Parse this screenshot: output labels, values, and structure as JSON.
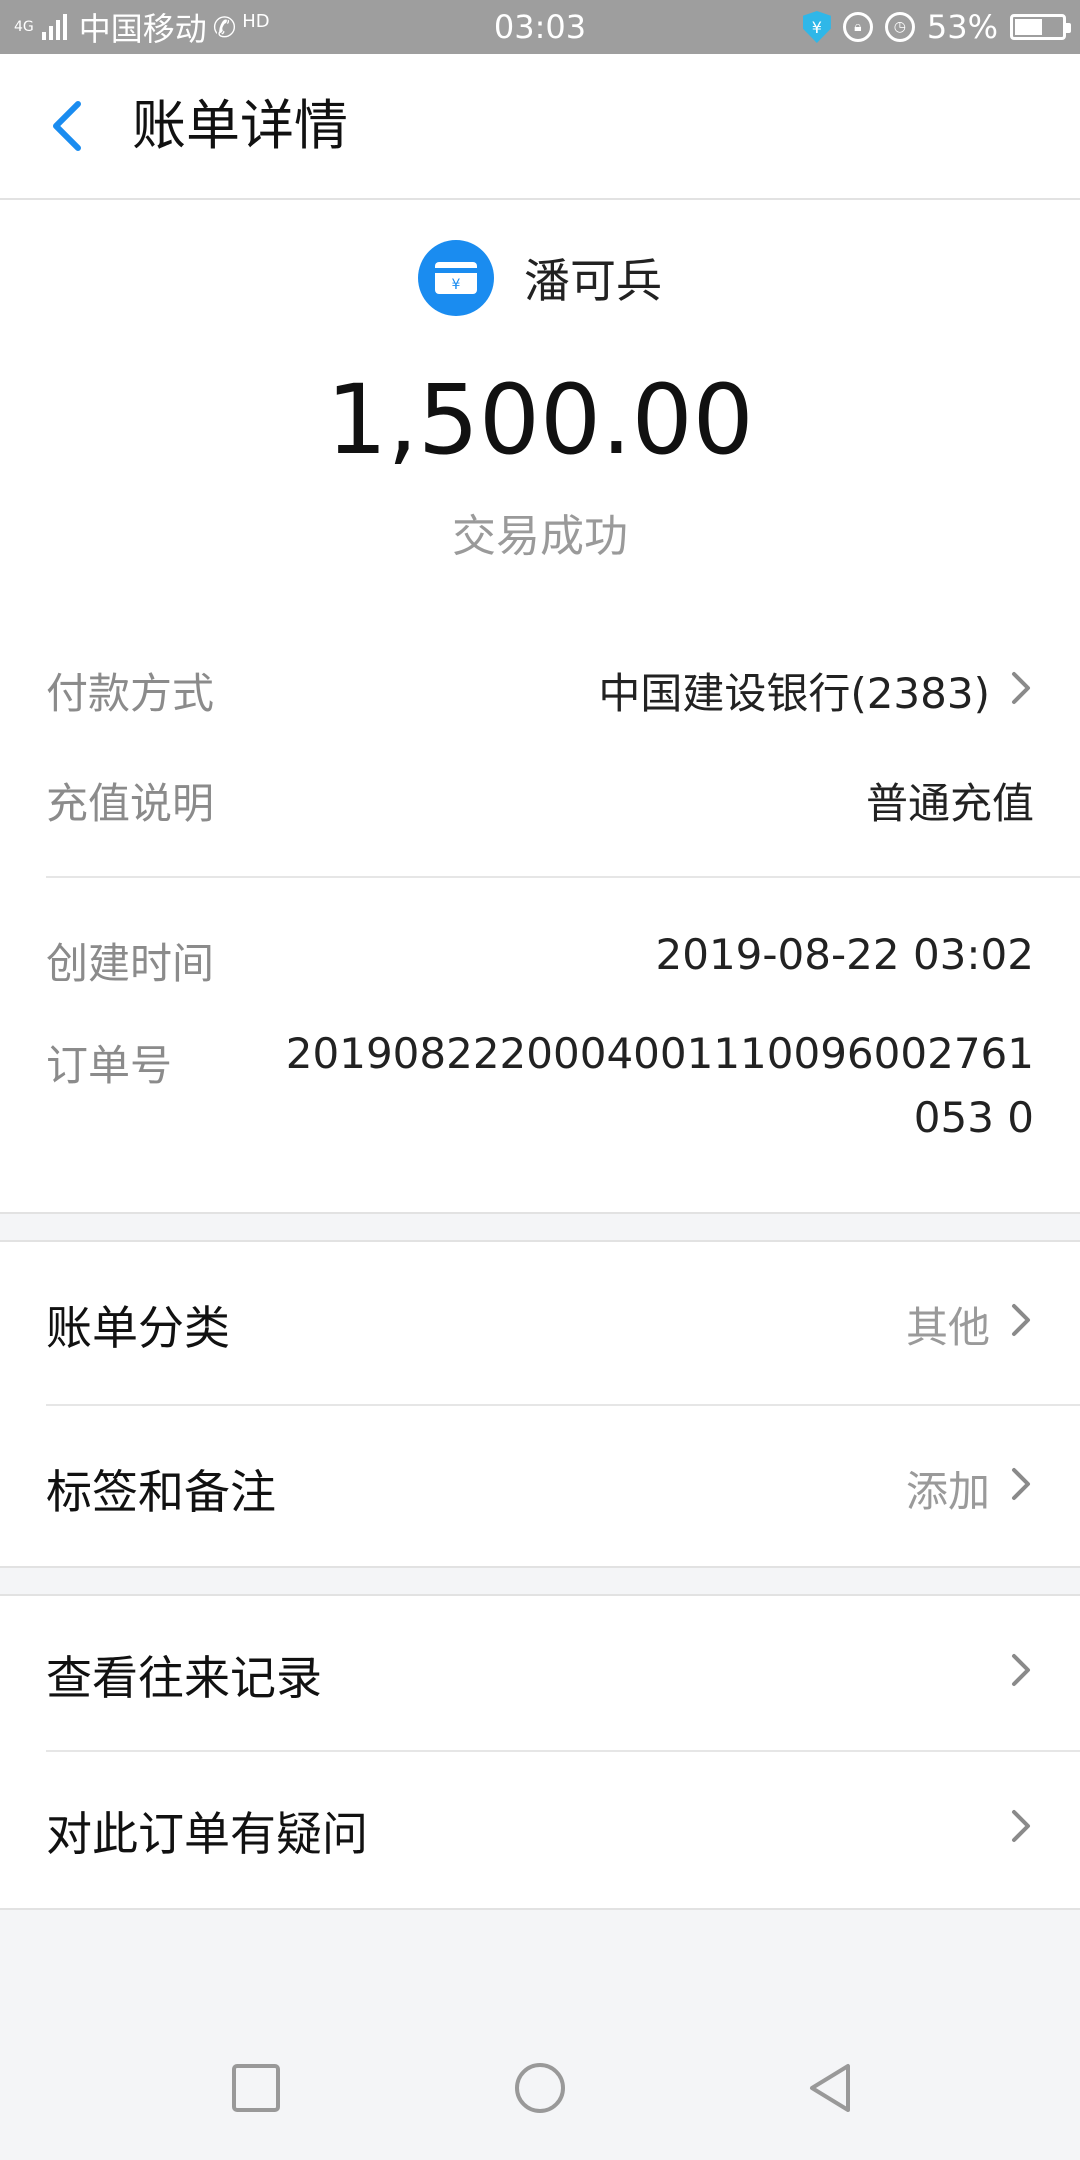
{
  "status_bar": {
    "network": "4G",
    "carrier": "中国移动",
    "hd": "HD",
    "time": "03:03",
    "battery": "53%"
  },
  "header": {
    "title": "账单详情"
  },
  "merchant": {
    "name": "潘可兵",
    "icon": "card-yuan-icon"
  },
  "amount": "1,500.00",
  "transaction_status": "交易成功",
  "details": {
    "payment_method_label": "付款方式",
    "payment_method_value": "中国建设银行(2383)",
    "recharge_label": "充值说明",
    "recharge_value": "普通充值",
    "created_label": "创建时间",
    "created_value": "2019-08-22 03:02",
    "order_label": "订单号",
    "order_value": "2019082220004001110096002761053 0"
  },
  "section1": {
    "category_label": "账单分类",
    "category_value": "其他",
    "tags_label": "标签和备注",
    "tags_value": "添加"
  },
  "section2": {
    "history_label": "查看往来记录",
    "question_label": "对此订单有疑问"
  },
  "colors": {
    "accent": "#1a8cf0",
    "status_bar": "#9e9e9e",
    "background": "#f4f5f7"
  }
}
